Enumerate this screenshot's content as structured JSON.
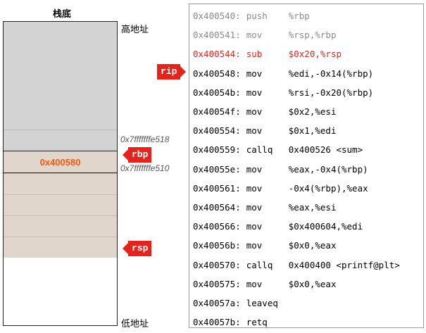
{
  "stack": {
    "title": "栈底",
    "high_label": "高地址",
    "low_label": "低地址",
    "rbp_cell_value": "0x400580",
    "addr_upper": "0x7fffffffe518",
    "addr_lower": "0x7fffffffe510"
  },
  "markers": {
    "rip": "rip",
    "rbp": "rbp",
    "rsp": "rsp"
  },
  "code": {
    "lines": [
      {
        "addr": "0x400540:",
        "op": "push",
        "args": "%rbp"
      },
      {
        "addr": "0x400541:",
        "op": "mov",
        "args": "%rsp,%rbp"
      },
      {
        "addr": "0x400544:",
        "op": "sub",
        "args": "$0x20,%rsp"
      },
      {
        "addr": "0x400548:",
        "op": "mov",
        "args": "%edi,-0x14(%rbp)"
      },
      {
        "addr": "0x40054b:",
        "op": "mov",
        "args": "%rsi,-0x20(%rbp)"
      },
      {
        "addr": "0x40054f:",
        "op": "mov",
        "args": "$0x2,%esi"
      },
      {
        "addr": "0x400554:",
        "op": "mov",
        "args": "$0x1,%edi"
      },
      {
        "addr": "0x400559:",
        "op": "callq",
        "args": "0x400526 <sum>"
      },
      {
        "addr": "0x40055e:",
        "op": "mov",
        "args": "%eax,-0x4(%rbp)"
      },
      {
        "addr": "0x400561:",
        "op": "mov",
        "args": "-0x4(%rbp),%eax"
      },
      {
        "addr": "0x400564:",
        "op": "mov",
        "args": "%eax,%esi"
      },
      {
        "addr": "0x400566:",
        "op": "mov",
        "args": "$0x400604,%edi"
      },
      {
        "addr": "0x40056b:",
        "op": "mov",
        "args": "$0x0,%eax"
      },
      {
        "addr": "0x400570:",
        "op": "callq",
        "args": "0x400400 <printf@plt>"
      },
      {
        "addr": "0x400575:",
        "op": "mov",
        "args": "$0x0,%eax"
      },
      {
        "addr": "0x40057a:",
        "op": "leaveq",
        "args": ""
      },
      {
        "addr": "0x40057b:",
        "op": "retq",
        "args": ""
      }
    ]
  },
  "colors": {
    "marker": "#e3241d",
    "executed_text": "#8a8a8a",
    "current_text": "#e3241d",
    "rbp_value_text": "#ef5a14",
    "old_stack": "#d3d3d3",
    "frame": "#e1d6cc"
  }
}
